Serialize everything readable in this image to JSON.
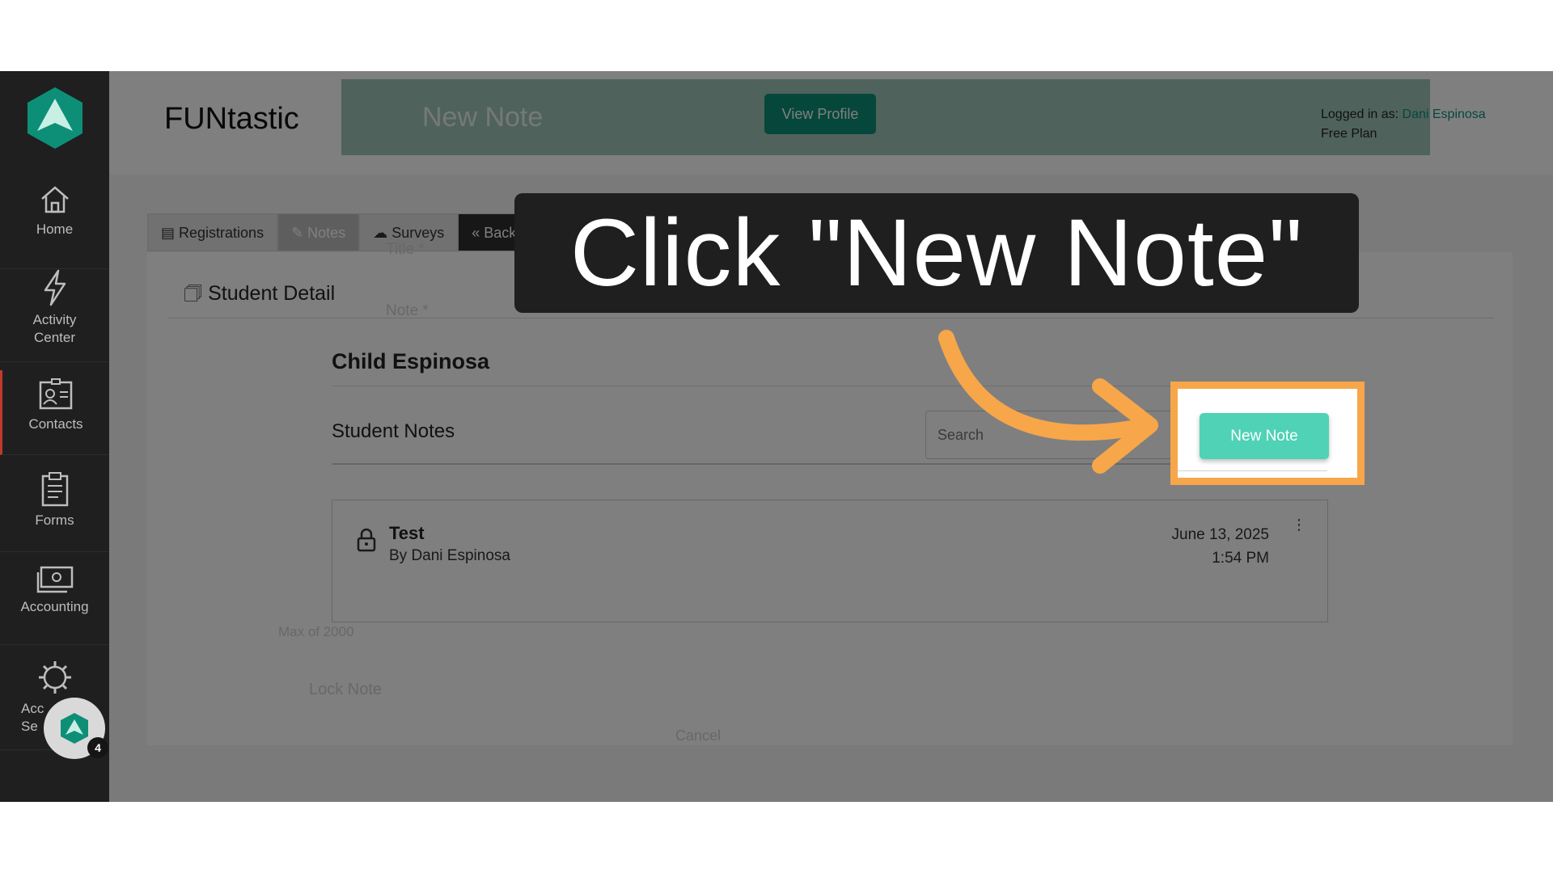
{
  "sidebar": {
    "items": [
      {
        "label": "Home",
        "icon": "home-icon"
      },
      {
        "label": "Activity\nCenter",
        "icon": "lightning-icon"
      },
      {
        "label": "Contacts",
        "icon": "contact-card-icon"
      },
      {
        "label": "Forms",
        "icon": "clipboard-icon"
      },
      {
        "label": "Accounting",
        "icon": "money-icon"
      },
      {
        "label": "Acc\nSe",
        "icon": "gear-icon"
      }
    ],
    "chat_badge": "4"
  },
  "header": {
    "org_name": "FUNtastic",
    "view_profile": "View Profile",
    "logged_in_prefix": "Logged in as: ",
    "user_name": "Dani Espinosa",
    "plan": "Free Plan"
  },
  "modal_ghost": {
    "title": "New Note",
    "title_field": "Title *",
    "note_field": "Note *",
    "max_chars": "Max of 2000",
    "lock_note": "Lock Note",
    "cancel": "Cancel"
  },
  "tabs": [
    "Registrations",
    "Notes",
    "Surveys",
    "« Back to List"
  ],
  "student_detail": {
    "title": "Student Detail",
    "student_name": "Child Espinosa",
    "notes_title": "Student Notes",
    "search_placeholder": "Search",
    "new_note": "New Note",
    "notes": [
      {
        "title": "Test",
        "author": "By Dani Espinosa",
        "date": "June 13, 2025",
        "time": "1:54 PM"
      }
    ]
  },
  "callout": "Click \"New Note\"",
  "colors": {
    "brand": "#0d8f77",
    "new_note_button": "#4fd2b5",
    "highlight": "#f7a64a",
    "sidebar": "#1f1f1f"
  }
}
